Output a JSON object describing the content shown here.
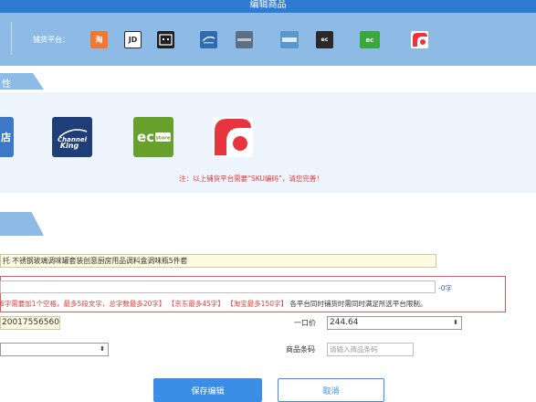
{
  "header": {
    "title": "编辑商品"
  },
  "platforms": {
    "label": "铺货平台：",
    "items": [
      {
        "name": "taobao",
        "glyph": "淘",
        "color": "#f07833"
      },
      {
        "name": "jd",
        "glyph": "JD",
        "color": "#2a2a2a"
      },
      {
        "name": "dark-store",
        "glyph": "▪",
        "color": "#1e1e1e"
      },
      {
        "name": "channel-king",
        "glyph": "",
        "color": "#2e6bb0"
      },
      {
        "name": "gray-store",
        "glyph": "",
        "color": "#5d6f83"
      },
      {
        "name": "store-blue",
        "glyph": "",
        "color": "#5a97cf"
      },
      {
        "name": "ec-dark",
        "glyph": "ec",
        "color": "#2a2a2a"
      },
      {
        "name": "ecstore",
        "glyph": "ec",
        "color": "#38a83a"
      },
      {
        "name": "red-brand",
        "glyph": "",
        "color": "#ffffff"
      }
    ]
  },
  "section1": {
    "tab_label": "性",
    "big_icons": [
      {
        "name": "store-icon",
        "glyph": "店",
        "color": "#3b78c8"
      },
      {
        "name": "channel-king-logo",
        "glyph": "Channel King 渠道王",
        "color": "#1f3e78"
      },
      {
        "name": "ecstore-logo",
        "glyph": "ec store",
        "color": "#68a02c"
      },
      {
        "name": "red-brand-logo",
        "glyph": "",
        "color": "#ffffff"
      }
    ],
    "note": "注：以上铺货平台需要“SKU编码”，请您完善！"
  },
  "form": {
    "title_value": "托 不锈钢玻璃调味罐套装创意厨房用品调料盒调味瓶5件套",
    "subtitle_value": "",
    "counter": "-0字",
    "hint_prefix": "6字需要加1个空格，最多5段文字，总字数最多20字】",
    "hint_jd": "【京东最多45字】",
    "hint_taobao": "【淘宝最多150字】",
    "hint_suffix": "各平台同时铺货时需同时满足所选平台限制。",
    "barcode_value": "20017556560",
    "price_label": "一口价",
    "price_value": "244.64",
    "select_left_value": "",
    "code_label": "商品条码",
    "code_placeholder": "请输入商品条码"
  },
  "buttons": {
    "save": "保存编辑",
    "cancel": "取消"
  },
  "colors": {
    "brand_blue": "#2f7bd4",
    "light_blue": "#8dbbe6",
    "warning_red": "#e03b3b",
    "highlight_field": "#fdfbe1"
  }
}
